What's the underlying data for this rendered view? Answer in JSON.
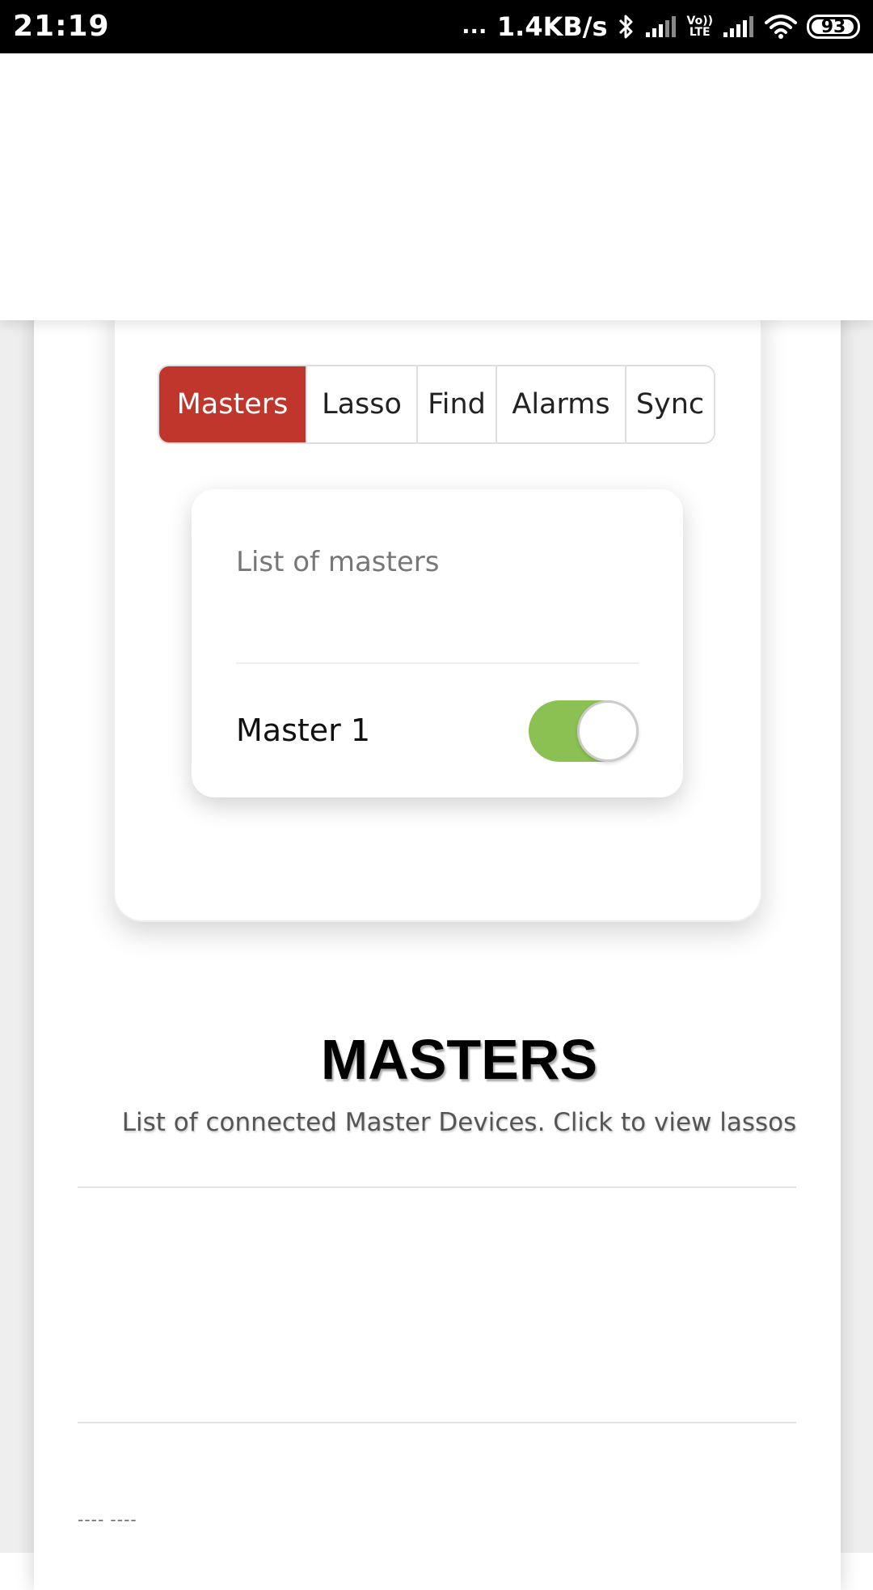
{
  "status_bar": {
    "time": "21:19",
    "dots": "...",
    "speed": "1.4KB/s",
    "volte_line1": "Vo))",
    "volte_line2": "LTE",
    "battery": "93"
  },
  "tabs": [
    {
      "label": "Masters",
      "active": true
    },
    {
      "label": "Lasso",
      "active": false
    },
    {
      "label": "Find",
      "active": false
    },
    {
      "label": "Alarms",
      "active": false
    },
    {
      "label": "Sync",
      "active": false
    }
  ],
  "masters_list": {
    "title": "List of masters",
    "items": [
      {
        "name": "Master 1",
        "enabled": true
      }
    ]
  },
  "section": {
    "title": "MASTERS",
    "subtitle": "List of connected Master Devices. Click to view lassos"
  },
  "footer": {
    "dashes": "---- ----"
  },
  "colors": {
    "active_tab": "#c0362c",
    "toggle_on": "#8bc152"
  },
  "icons": [
    "bluetooth-icon",
    "signal-icon",
    "wifi-icon",
    "battery-icon"
  ]
}
